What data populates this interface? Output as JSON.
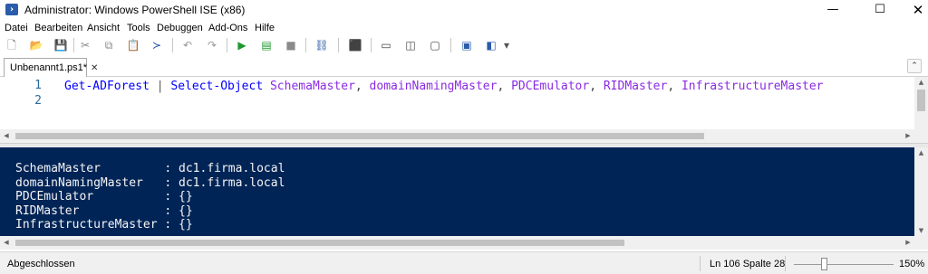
{
  "window": {
    "title": "Administrator: Windows PowerShell ISE (x86)",
    "icon": "powershell-icon",
    "minimize_glyph": "—",
    "maximize_glyph": "☐",
    "close_glyph": "✕"
  },
  "menu": [
    "Datei",
    "Bearbeiten",
    "Ansicht",
    "Tools",
    "Debuggen",
    "Add-Ons",
    "Hilfe"
  ],
  "toolbar": {
    "icons": [
      {
        "name": "new-icon",
        "glyph": "🗋",
        "color": "#6b6b6b"
      },
      {
        "name": "open-icon",
        "glyph": "📂",
        "color": "#d9a520"
      },
      {
        "name": "save-icon",
        "glyph": "💾",
        "color": "#3a5fb0"
      },
      {
        "name": "cut-icon",
        "glyph": "✂",
        "color": "#8a8a8a"
      },
      {
        "name": "copy-icon",
        "glyph": "⧉",
        "color": "#8a8a8a"
      },
      {
        "name": "paste-icon",
        "glyph": "📋",
        "color": "#555555"
      },
      {
        "name": "clear-console-icon",
        "glyph": "≻",
        "color": "#1f4ea8"
      },
      {
        "name": "undo-icon",
        "glyph": "↶",
        "color": "#9a9a9a"
      },
      {
        "name": "redo-icon",
        "glyph": "↷",
        "color": "#9a9a9a"
      },
      {
        "name": "run-icon",
        "glyph": "▶",
        "color": "#1e9a2e"
      },
      {
        "name": "run-selection-icon",
        "glyph": "▤",
        "color": "#1e9a2e"
      },
      {
        "name": "stop-icon",
        "glyph": "■",
        "color": "#8a8a8a"
      },
      {
        "name": "remote-powershell-icon",
        "glyph": "⛓",
        "color": "#2b5fa8"
      },
      {
        "name": "powershell-console-icon",
        "glyph": "⬛",
        "color": "#2a5caa"
      },
      {
        "name": "show-script-top-icon",
        "glyph": "▭",
        "color": "#444444"
      },
      {
        "name": "show-script-right-icon",
        "glyph": "◫",
        "color": "#444444"
      },
      {
        "name": "show-script-maximized-icon",
        "glyph": "▢",
        "color": "#444444"
      },
      {
        "name": "show-command-icon",
        "glyph": "▣",
        "color": "#2a5caa"
      },
      {
        "name": "show-command-addon-icon",
        "glyph": "◧",
        "color": "#2a5caa"
      },
      {
        "name": "customize-toolbar-icon",
        "glyph": "▾",
        "color": "#555555"
      }
    ]
  },
  "tabs": [
    {
      "label": "Unbenannt1.ps1*",
      "close_glyph": "✕"
    }
  ],
  "collapse_glyph": "⌃",
  "editor": {
    "line_numbers": [
      "1",
      "2"
    ],
    "line1": {
      "cmd1": "Get-ADForest",
      "pipe": " | ",
      "cmd2": "Select-Object",
      "args": [
        {
          "text": " SchemaMaster",
          "sep": ","
        },
        {
          "text": " domainNamingMaster",
          "sep": ","
        },
        {
          "text": " PDCEmulator",
          "sep": ","
        },
        {
          "text": " RIDMaster",
          "sep": ","
        },
        {
          "text": " InfrastructureMaster",
          "sep": ""
        }
      ]
    }
  },
  "console": {
    "lines": [
      "SchemaMaster         : dc1.firma.local",
      "domainNamingMaster   : dc1.firma.local",
      "PDCEmulator          : {}",
      "RIDMaster            : {}",
      "InfrastructureMaster : {}"
    ],
    "background": "#012456"
  },
  "status": {
    "state": "Abgeschlossen",
    "position": "Ln 106  Spalte 28",
    "zoom": "150%",
    "zoom_level": 0.3
  },
  "scroll": {
    "up": "▲",
    "down": "▼",
    "left": "◀",
    "right": "▶"
  }
}
